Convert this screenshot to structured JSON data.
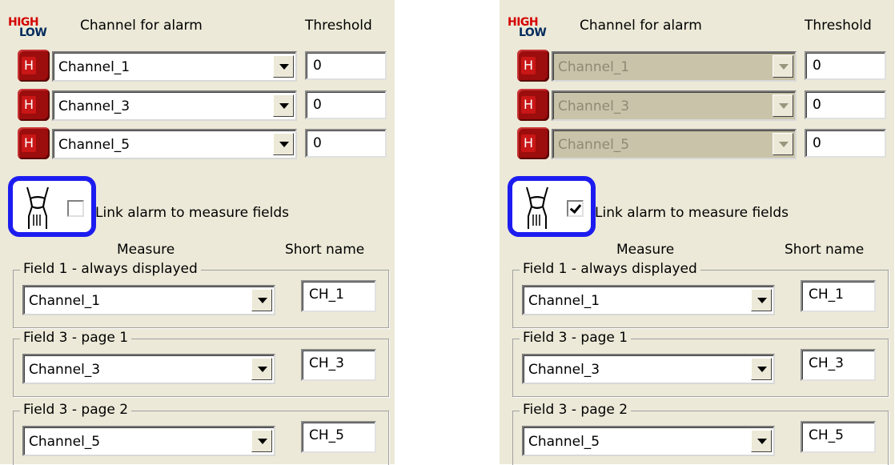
{
  "panels": [
    {
      "state": "unchecked",
      "logo": {
        "high": "HIGH",
        "low": "LOW"
      },
      "header": {
        "channel_label": "Channel for alarm",
        "threshold_label": "Threshold"
      },
      "alarm_rows": [
        {
          "button": "H",
          "channel": "Channel_1",
          "threshold": "0"
        },
        {
          "button": "H",
          "channel": "Channel_3",
          "threshold": "0"
        },
        {
          "button": "H",
          "channel": "Channel_5",
          "threshold": "0"
        }
      ],
      "link": {
        "label": "Link alarm to measure fields",
        "checked": false
      },
      "columns": {
        "measure": "Measure",
        "short_name": "Short name"
      },
      "fields": [
        {
          "title": "Field 1 - always displayed",
          "channel": "Channel_1",
          "short": "CH_1"
        },
        {
          "title": "Field 3 - page 1",
          "channel": "Channel_3",
          "short": "CH_3"
        },
        {
          "title": "Field 3 - page 2",
          "channel": "Channel_5",
          "short": "CH_5"
        }
      ]
    },
    {
      "state": "checked",
      "logo": {
        "high": "HIGH",
        "low": "LOW"
      },
      "header": {
        "channel_label": "Channel for alarm",
        "threshold_label": "Threshold"
      },
      "alarm_rows": [
        {
          "button": "H",
          "channel": "Channel_1",
          "threshold": "0"
        },
        {
          "button": "H",
          "channel": "Channel_3",
          "threshold": "0"
        },
        {
          "button": "H",
          "channel": "Channel_5",
          "threshold": "0"
        }
      ],
      "link": {
        "label": "Link alarm to measure fields",
        "checked": true
      },
      "columns": {
        "measure": "Measure",
        "short_name": "Short name"
      },
      "fields": [
        {
          "title": "Field 1 - always displayed",
          "channel": "Channel_1",
          "short": "CH_1"
        },
        {
          "title": "Field 3 - page 1",
          "channel": "Channel_3",
          "short": "CH_3"
        },
        {
          "title": "Field 3 - page 2",
          "channel": "Channel_5",
          "short": "CH_5"
        }
      ]
    }
  ],
  "colors": {
    "panel_bg": "#ece9d8",
    "highlight_frame": "#1c1cf0",
    "h_button": "#9c0d0d",
    "disabled_combo": "#c9c3a9"
  }
}
